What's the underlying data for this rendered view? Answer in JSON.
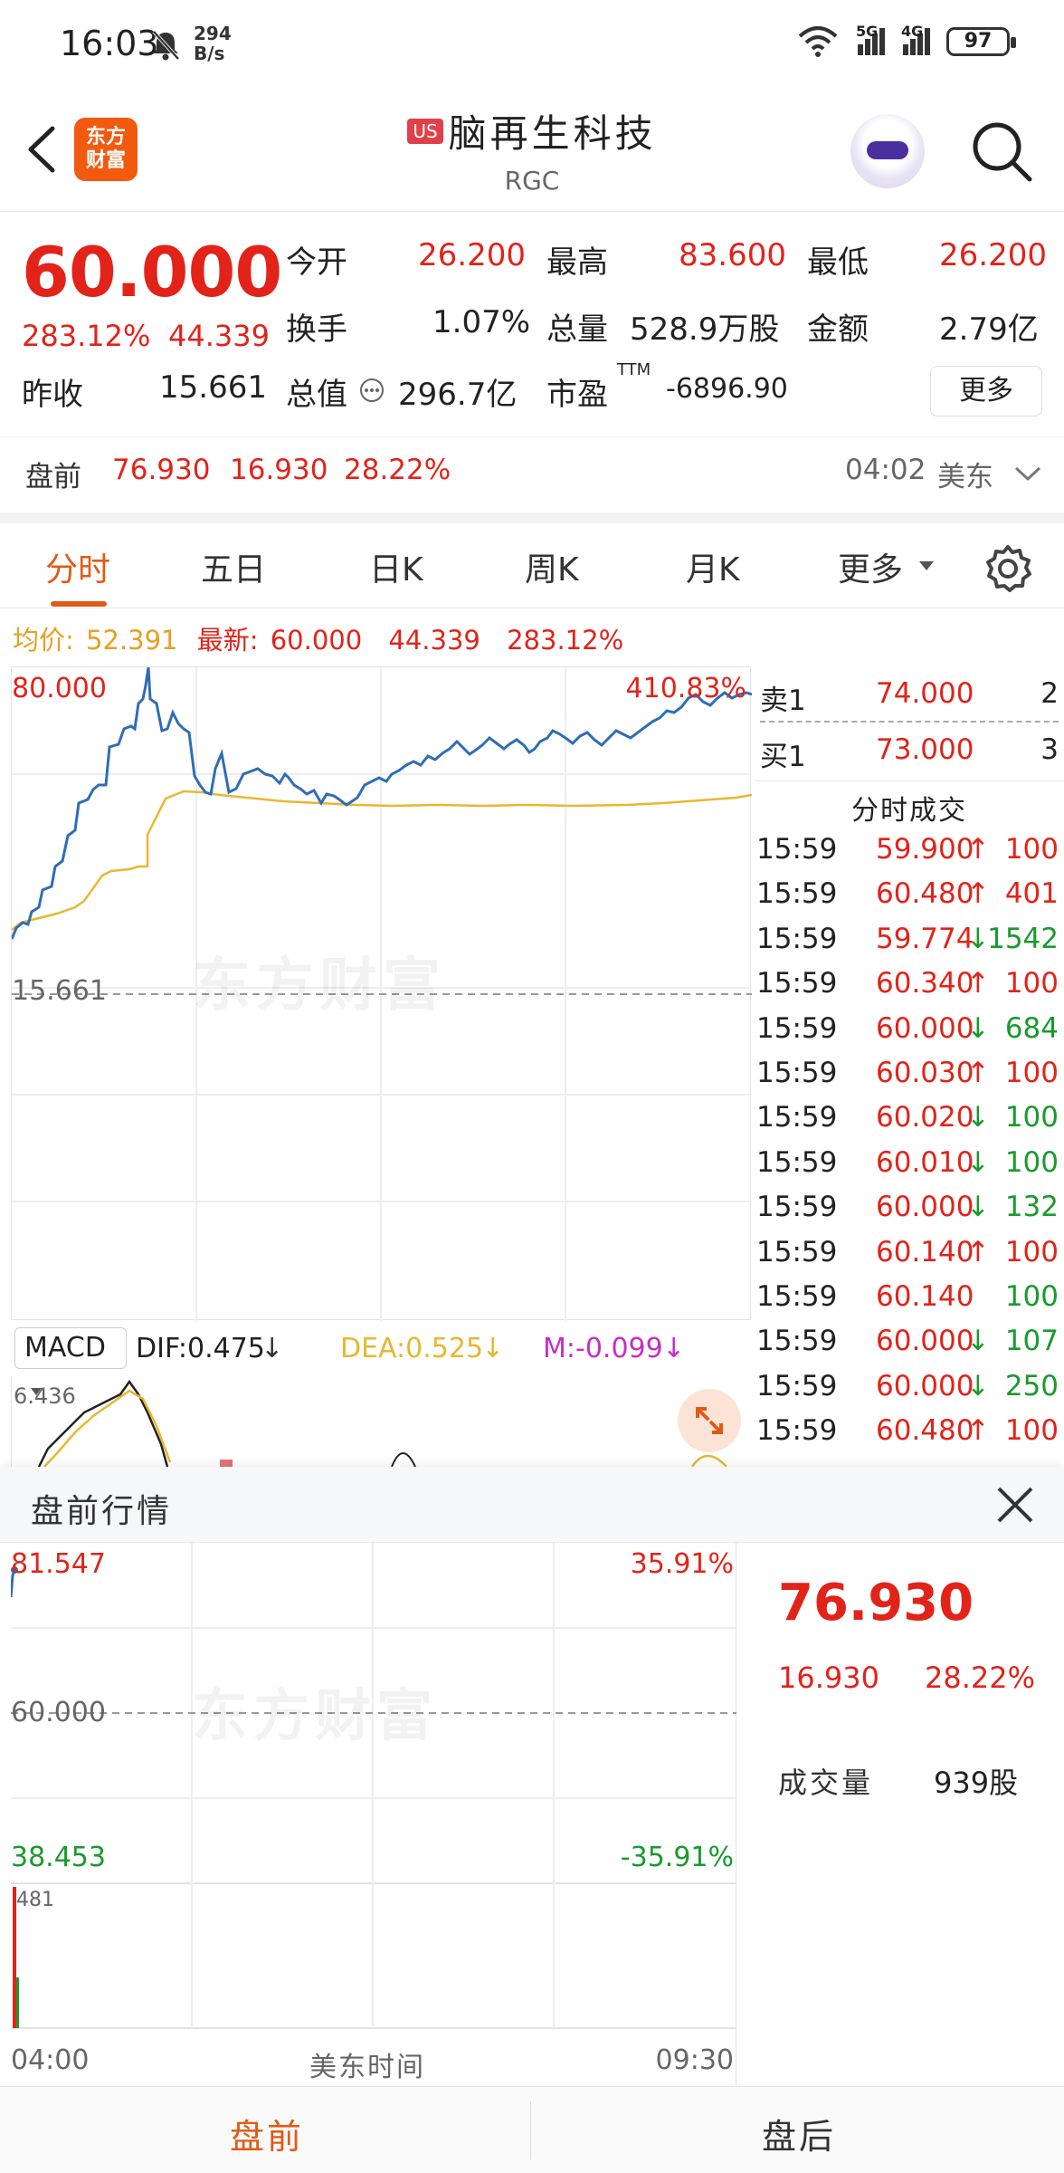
{
  "status": {
    "time": "16:03",
    "net_rate": "294",
    "net_unit": "B/s",
    "sig1": "5G",
    "sig2": "4G",
    "battery": "97"
  },
  "header": {
    "logo_line1": "东方",
    "logo_line2": "财富",
    "market_badge": "US",
    "name": "脑再生科技",
    "code": "RGC"
  },
  "quote": {
    "price": "60.000",
    "change_pct": "283.12%",
    "change": "44.339",
    "prev_close_label": "昨收",
    "prev_close": "15.661",
    "open_label": "今开",
    "open": "26.200",
    "high_label": "最高",
    "high": "83.600",
    "low_label": "最低",
    "low": "26.200",
    "turnover_label": "换手",
    "turnover": "1.07%",
    "volume_label": "总量",
    "volume": "528.9万股",
    "amount_label": "金额",
    "amount": "2.79亿",
    "mcap_label": "总值",
    "mcap": "296.7亿",
    "pe_label": "市盈",
    "pe_sup": "TTM",
    "pe": "-6896.90",
    "more": "更多",
    "pre_label": "盘前",
    "pre_price": "76.930",
    "pre_change": "16.930",
    "pre_pct": "28.22%",
    "pre_time": "04:02",
    "pre_zone": "美东"
  },
  "tabs": [
    "分时",
    "五日",
    "日K",
    "周K",
    "月K",
    "更多"
  ],
  "avg_line": {
    "avg_label": "均价:",
    "avg": "52.391",
    "latest_label": "最新:",
    "latest": "60.000",
    "chg": "44.339",
    "pct": "283.12%"
  },
  "chart": {
    "top_price": "80.000",
    "top_pct": "410.83%",
    "base_price": "15.661",
    "watermark": "东方财富"
  },
  "macd": {
    "name": "MACD",
    "dif": "DIF:0.475",
    "dea": "DEA:0.525",
    "m": "M:-0.099",
    "top": "6.436"
  },
  "orderbook": {
    "sell_label": "卖1",
    "sell_price": "74.000",
    "sell_qty": "2",
    "buy_label": "买1",
    "buy_price": "73.000",
    "buy_qty": "3",
    "trades_title": "分时成交",
    "trades": [
      {
        "t": "15:59",
        "p": "59.900",
        "d": "up",
        "q": "100",
        "qc": "red"
      },
      {
        "t": "15:59",
        "p": "60.480",
        "d": "up",
        "q": "401",
        "qc": "red"
      },
      {
        "t": "15:59",
        "p": "59.774",
        "d": "down",
        "q": "1542",
        "qc": "green"
      },
      {
        "t": "15:59",
        "p": "60.340",
        "d": "up",
        "q": "100",
        "qc": "red"
      },
      {
        "t": "15:59",
        "p": "60.000",
        "d": "down",
        "q": "684",
        "qc": "green"
      },
      {
        "t": "15:59",
        "p": "60.030",
        "d": "up",
        "q": "100",
        "qc": "red"
      },
      {
        "t": "15:59",
        "p": "60.020",
        "d": "down",
        "q": "100",
        "qc": "green"
      },
      {
        "t": "15:59",
        "p": "60.010",
        "d": "down",
        "q": "100",
        "qc": "green"
      },
      {
        "t": "15:59",
        "p": "60.000",
        "d": "down",
        "q": "132",
        "qc": "green"
      },
      {
        "t": "15:59",
        "p": "60.140",
        "d": "up",
        "q": "100",
        "qc": "red"
      },
      {
        "t": "15:59",
        "p": "60.140",
        "d": "",
        "q": "100",
        "qc": "green"
      },
      {
        "t": "15:59",
        "p": "60.000",
        "d": "down",
        "q": "107",
        "qc": "green"
      },
      {
        "t": "15:59",
        "p": "60.000",
        "d": "down",
        "q": "250",
        "qc": "green"
      },
      {
        "t": "15:59",
        "p": "60.480",
        "d": "up",
        "q": "100",
        "qc": "red"
      }
    ]
  },
  "premarket": {
    "title": "盘前行情",
    "top_price": "81.547",
    "top_pct": "35.91%",
    "mid_price": "60.000",
    "bottom_price": "38.453",
    "bottom_pct": "-35.91%",
    "vol_top": "481",
    "x_start": "04:00",
    "x_mid": "美东时间",
    "x_end": "09:30",
    "price": "76.930",
    "change": "16.930",
    "pct": "28.22%",
    "vol_label": "成交量",
    "vol": "939股",
    "watermark": "东方财富"
  },
  "bottom_tabs": {
    "pre": "盘前",
    "post": "盘后"
  },
  "colors": {
    "up": "#e2231a",
    "down": "#1a9a2e",
    "accent": "#e05a17",
    "price_line": "#2f6db5",
    "avg_line": "#e8b730"
  }
}
